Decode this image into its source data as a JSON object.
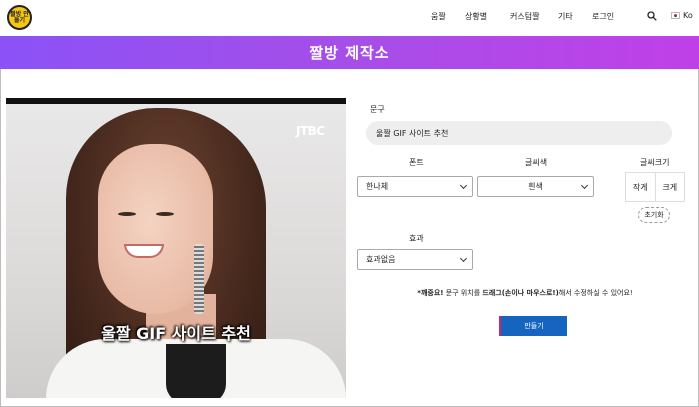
{
  "header": {
    "logo_text": "짤방 만들기",
    "nav": [
      "움짤",
      "상황별",
      "커스텀짤",
      "기타",
      "로그인"
    ],
    "lang_label": "Ko"
  },
  "banner": {
    "title": "짤방 제작소"
  },
  "video": {
    "watermark": "JTBC",
    "caption": "울짤 GIF 사이트 추천"
  },
  "form": {
    "phrase_label": "문구",
    "phrase_value": "울짤 GIF 사이트 추천",
    "font_label": "폰트",
    "font_value": "한나체",
    "color_label": "글씨색",
    "color_value": "흰색",
    "size_label": "글씨크기",
    "size_small": "작게",
    "size_large": "크게",
    "reset_label": "초기화",
    "effect_label": "효과",
    "effect_value": "효과없음",
    "notice_prefix": "*깨중요!",
    "notice_part1": "문구 위치를",
    "notice_bold": "드래그(손이나 마우스로!)",
    "notice_part2": "해서 수정하실 수 있어요!",
    "make_button": "만들기"
  },
  "colors": {
    "banner_start": "#8b52f7",
    "banner_end": "#c040e8",
    "button": "#1565c0",
    "logo": "#f5c518"
  }
}
